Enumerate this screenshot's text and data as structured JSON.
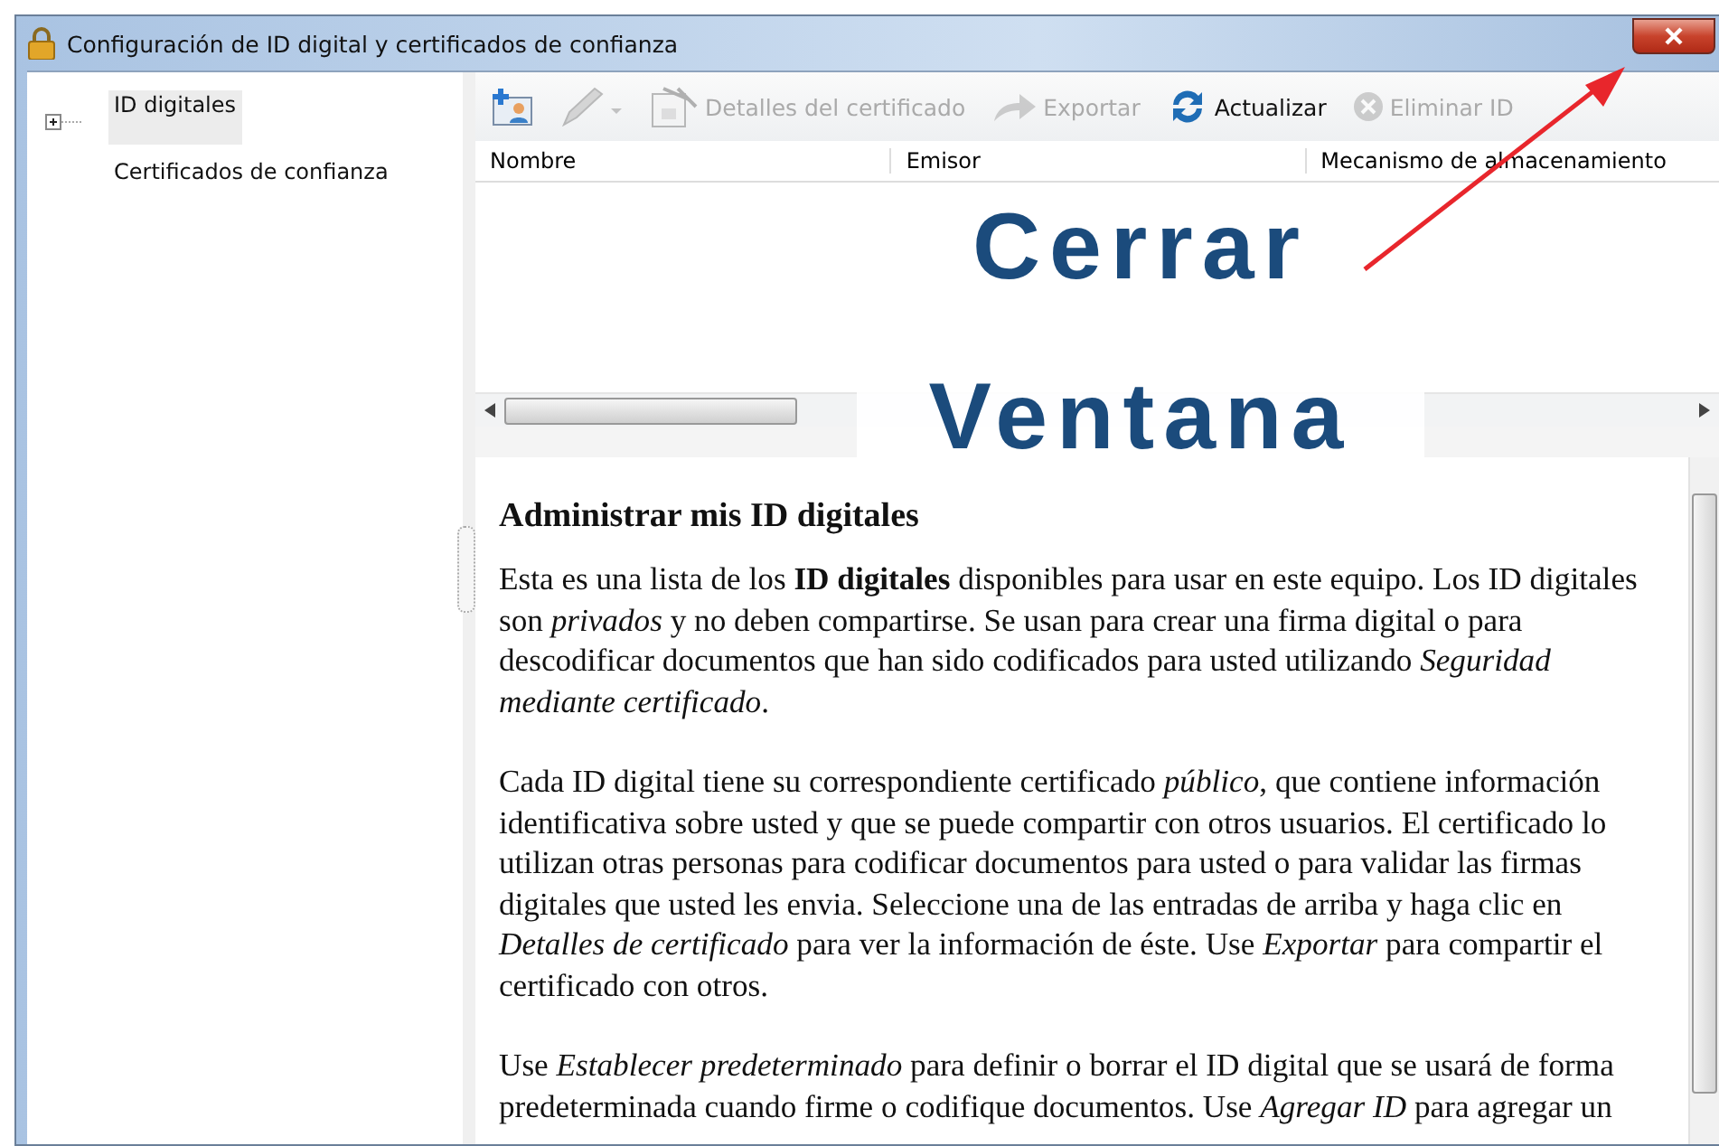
{
  "window": {
    "title": "Configuración de ID digital y certificados de confianza"
  },
  "tree": [
    {
      "label": "ID digitales",
      "selected": true,
      "expanded": false
    },
    {
      "label": "Certificados de confianza",
      "selected": false
    }
  ],
  "toolbar": [
    {
      "kind": "add-id",
      "disabled": false
    },
    {
      "kind": "pen",
      "disabled": true
    },
    {
      "kind": "details",
      "label": "Detalles del certificado",
      "disabled": true
    },
    {
      "kind": "export",
      "label": "Exportar",
      "disabled": true
    },
    {
      "kind": "refresh",
      "label": "Actualizar",
      "disabled": false
    },
    {
      "kind": "remove",
      "label": "Eliminar ID",
      "disabled": true
    }
  ],
  "table": {
    "columns": [
      "Nombre",
      "Emisor",
      "Mecanismo de almacenamiento"
    ]
  },
  "help": {
    "heading": "Administrar mis ID digitales",
    "paragraphs": [
      "Esta es una lista de los **ID digitales** disponibles para usar en este equipo. Los ID digitales son *privados* y no deben compartirse. Se usan para crear una firma digital o para descodificar documentos que han sido codificados para usted utilizando *Seguridad mediante certificado*.",
      "Cada ID digital tiene su correspondiente certificado *público*, que contiene información identificativa sobre usted y que se puede compartir con otros usuarios. El certificado lo utilizan otras personas para codificar documentos para usted o para validar las firmas digitales que usted les envia. Seleccione una de las entradas de arriba y haga clic en *Detalles de certificado* para ver la información de éste. Use *Exportar* para compartir el certificado con otros.",
      "Use *Establecer predeterminado* para definir o borrar el ID digital que se usará de forma predeterminada cuando firme o codifique documentos. Use *Agregar ID* para agregar un"
    ]
  },
  "annotation": {
    "lines": [
      "Cerrar",
      "Ventana"
    ]
  }
}
